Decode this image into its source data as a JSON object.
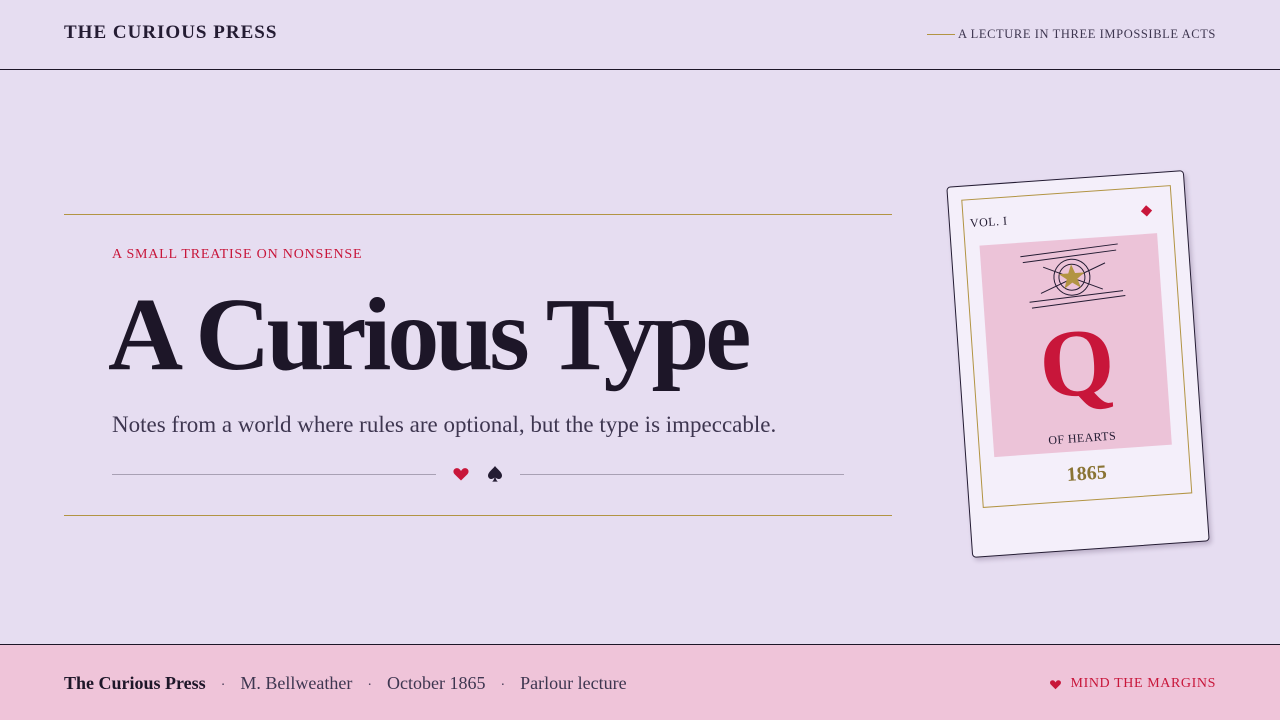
{
  "header": {
    "brand": "THE CURIOUS PRESS",
    "tagline": "A LECTURE IN THREE IMPOSSIBLE ACTS"
  },
  "hero": {
    "eyebrow": "A SMALL TREATISE ON NONSENSE",
    "title": "A Curious Type",
    "subtitle": "Notes from a world where rules are optional, but the type is impeccable.",
    "ornament_icons": [
      "heart-icon",
      "spade-icon"
    ]
  },
  "card": {
    "volume": "VOL. I",
    "rank": "Q",
    "suit_label": "OF HEARTS",
    "year": "1865",
    "corner_icon": "diamond-icon",
    "emblem_icon": "star-seal-icon"
  },
  "footer": {
    "publisher": "The Curious Press",
    "author": "M. Bellweather",
    "date": "October 1865",
    "format": "Parlour lecture",
    "motto": "MIND THE MARGINS",
    "motto_icon": "heart-icon"
  },
  "colors": {
    "background": "#e6ddf1",
    "ink": "#1d1628",
    "accent_red": "#c8163a",
    "accent_gold": "#b29443",
    "footer_bg": "#efc4d9",
    "card_art_bg": "#ecc3d8"
  }
}
